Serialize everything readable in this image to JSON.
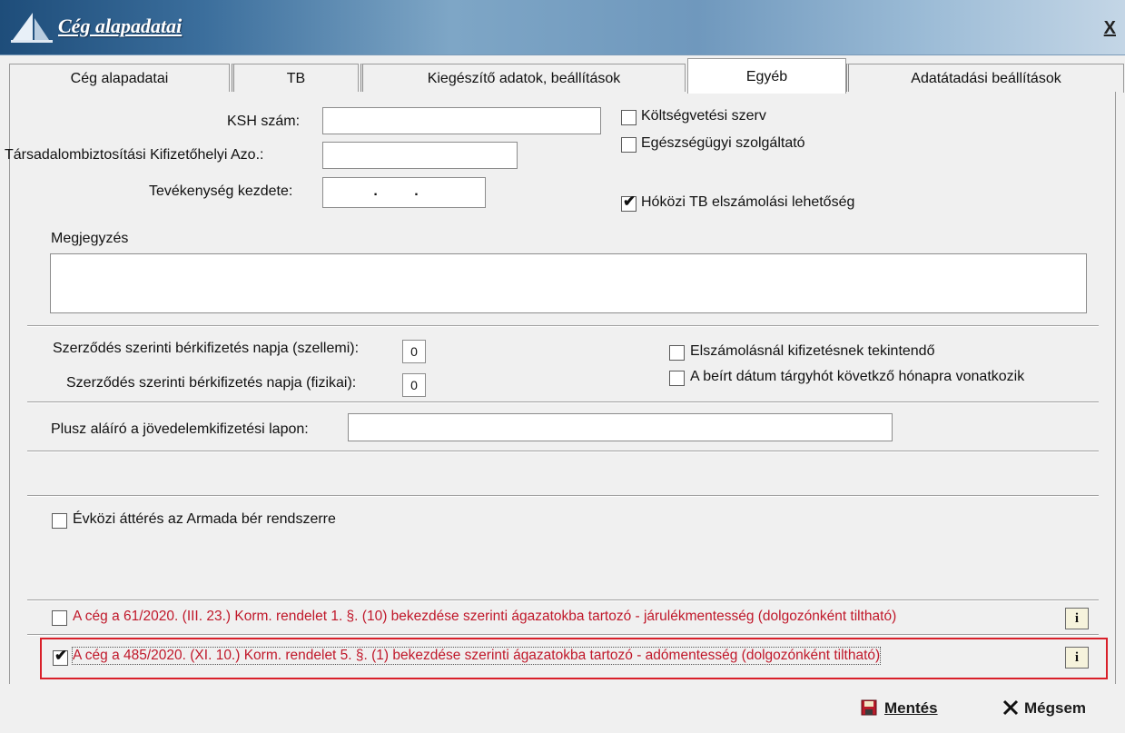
{
  "window": {
    "title": "Cég alapadatai",
    "close_label": "X"
  },
  "tabs": [
    {
      "label": "Cég alapadatai"
    },
    {
      "label": "TB"
    },
    {
      "label": "Kiegészítő adatok, beállítások"
    },
    {
      "label": "Egyéb"
    },
    {
      "label": "Adatátadási beállítások"
    }
  ],
  "fields": {
    "ksh_label": "KSH szám:",
    "tb_label": "Társadalombiztosítási Kifizetőhelyi Azo.:",
    "activity_start_label": "Tevékenység kezdete:",
    "activity_start_value": ". .",
    "notes_label": "Megjegyzés",
    "salary_day_mental_label": "Szerződés szerinti bérkifizetés napja (szellemi):",
    "salary_day_mental_value": "0",
    "salary_day_physical_label": "Szerződés szerinti bérkifizetés napja (fizikai):",
    "salary_day_physical_value": "0",
    "extra_signer_label": "Plusz aláíró a jövedelemkifizetési lapon:"
  },
  "checkboxes": {
    "budget_org": {
      "label": "Költségvetési szerv",
      "checked": false
    },
    "health_provider": {
      "label": "Egészségügyi szolgáltató",
      "checked": false
    },
    "midmonth_tb": {
      "label": "Hóközi TB elszámolási lehetőség",
      "checked": true
    },
    "treat_as_payment": {
      "label": "Elszámolásnál kifizetésnek tekintendő",
      "checked": false
    },
    "next_month_date": {
      "label": "A beírt dátum tárgyhót követkző hónapra vonatkozik",
      "checked": false
    },
    "armada_switch": {
      "label": "Évközi áttérés az Armada bér rendszerre",
      "checked": false
    },
    "decree_61": {
      "label": "A cég a  61/2020. (III. 23.) Korm. rendelet 1. §. (10) bekezdése szerinti ágazatokba tartozó - járulékmentesség (dolgozónként tiltható)",
      "checked": false
    },
    "decree_485": {
      "label": "A cég a 485/2020. (XI. 10.) Korm. rendelet 5. §. (1) bekezdése szerinti ágazatokba tartozó - adómentesség (dolgozónként tiltható)",
      "checked": true
    }
  },
  "info_icon_glyph": "i",
  "check_glyph": "✔",
  "buttons": {
    "save_label": "Mentés",
    "cancel_label": "Mégsem"
  },
  "colors": {
    "highlight_border": "#d9202a",
    "decree_text": "#c0182a"
  }
}
